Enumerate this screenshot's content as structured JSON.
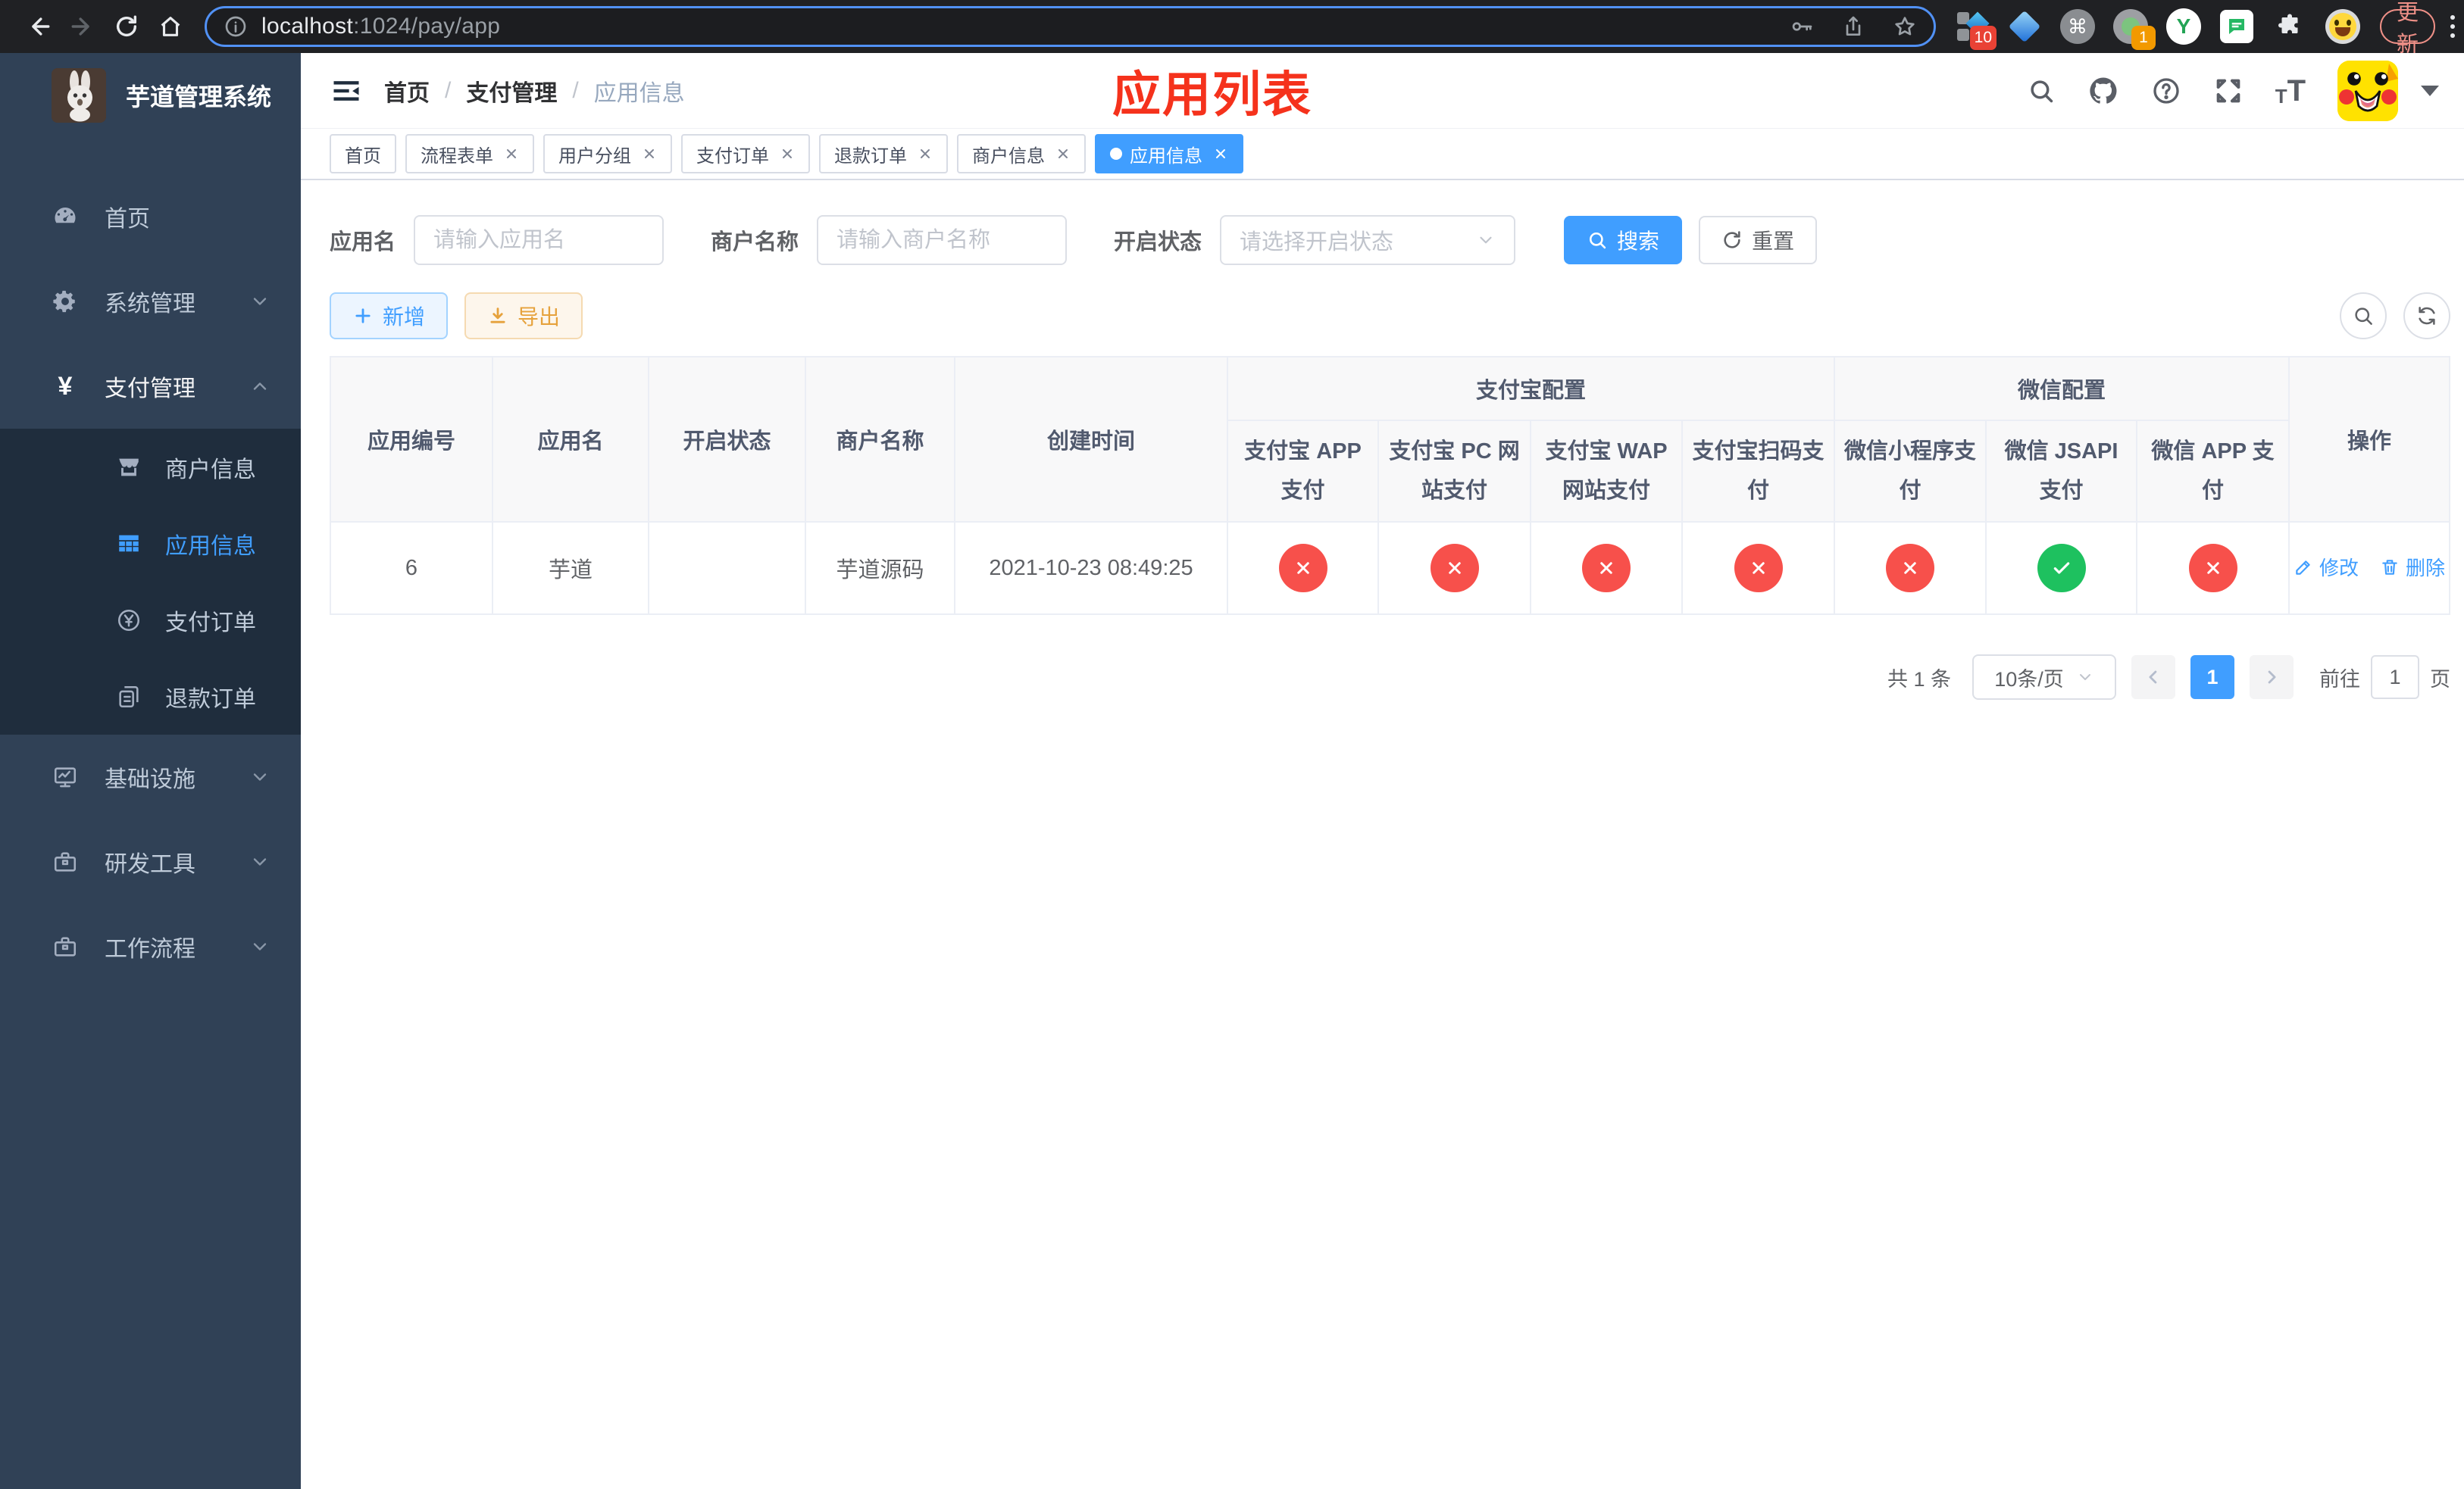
{
  "browser": {
    "url": {
      "host": "localhost",
      "rest": ":1024/pay/app"
    },
    "update_label": "更新",
    "extension_badges": {
      "first": "10",
      "second": "1"
    },
    "glyphs": {
      "command": "⌘",
      "y_ext": "Y",
      "t_small": "T",
      "t_big": "T"
    }
  },
  "sidebar": {
    "title": "芋道管理系统",
    "menu_top": [
      {
        "label": "首页"
      },
      {
        "label": "系统管理"
      },
      {
        "label": "支付管理"
      }
    ],
    "submenu": [
      {
        "label": "商户信息"
      },
      {
        "label": "应用信息"
      },
      {
        "label": "支付订单"
      },
      {
        "label": "退款订单"
      }
    ],
    "menu_bottom": [
      {
        "label": "基础设施"
      },
      {
        "label": "研发工具"
      },
      {
        "label": "工作流程"
      }
    ]
  },
  "navbar": {
    "breadcrumb": [
      "首页",
      "支付管理",
      "应用信息"
    ],
    "breadcrumb_sep": "/",
    "annotation": "应用列表"
  },
  "tags": [
    {
      "label": "首页"
    },
    {
      "label": "流程表单"
    },
    {
      "label": "用户分组"
    },
    {
      "label": "支付订单"
    },
    {
      "label": "退款订单"
    },
    {
      "label": "商户信息"
    },
    {
      "label": "应用信息"
    }
  ],
  "filters": {
    "app_name": {
      "label": "应用名",
      "placeholder": "请输入应用名",
      "value": ""
    },
    "merchant_name": {
      "label": "商户名称",
      "placeholder": "请输入商户名称",
      "value": ""
    },
    "status": {
      "label": "开启状态",
      "placeholder": "请选择开启状态"
    },
    "search_label": "搜索",
    "reset_label": "重置"
  },
  "toolbar": {
    "add_label": "新增",
    "export_label": "导出"
  },
  "table": {
    "groups": {
      "alipay": "支付宝配置",
      "wechat": "微信配置"
    },
    "columns": [
      "应用编号",
      "应用名",
      "开启状态",
      "商户名称",
      "创建时间",
      "支付宝 APP 支付",
      "支付宝 PC 网站支付",
      "支付宝 WAP 网站支付",
      "支付宝扫码支付",
      "微信小程序支付",
      "微信 JSAPI 支付",
      "微信 APP 支付",
      "操作"
    ],
    "row": {
      "id": "6",
      "name": "芋道",
      "enabled": true,
      "merchant": "芋道源码",
      "created_at": "2021-10-23 08:49:25",
      "alipay_app": "disabled",
      "alipay_pc": "disabled",
      "alipay_wap": "disabled",
      "alipay_qr": "disabled",
      "wechat_lite": "disabled",
      "wechat_jsapi": "enabled",
      "wechat_app": "disabled",
      "edit_label": "修改",
      "delete_label": "删除"
    }
  },
  "pagination": {
    "total_label": "共 1 条",
    "page_size": "10条/页",
    "current_page": "1",
    "goto_label": "前往",
    "goto_value": "1",
    "page_unit": "页"
  },
  "colors": {
    "primary": "#409EFF",
    "danger": "#f7504b",
    "success": "#1ec15f",
    "warning": "#e6a23c",
    "annotation": "#f5321c",
    "sidebar_bg": "#304156",
    "submenu_bg": "#1f2d3d"
  }
}
